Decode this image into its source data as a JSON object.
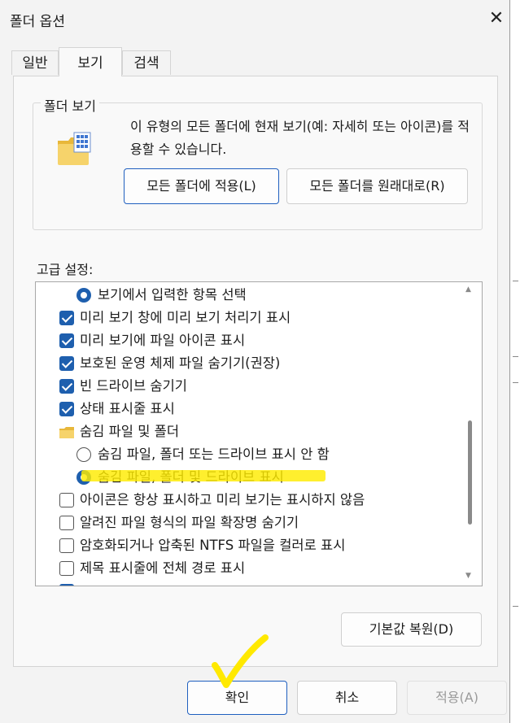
{
  "window": {
    "title": "폴더 옵션",
    "close_symbol": "✕"
  },
  "tabs": [
    {
      "label": "일반",
      "active": false
    },
    {
      "label": "보기",
      "active": true
    },
    {
      "label": "검색",
      "active": false
    }
  ],
  "folder_view": {
    "legend": "폴더 보기",
    "description": "이 유형의 모든 폴더에 현재 보기(예: 자세히 또는 아이콘)를 적용할 수 있습니다.",
    "apply_button": "모든 폴더에 적용(L)",
    "reset_button": "모든 폴더를 원래대로(R)",
    "icon": "folder-view-icon"
  },
  "advanced": {
    "label": "고급 설정:",
    "items": [
      {
        "type": "radio",
        "checked": true,
        "indent": 1,
        "label": "보기에서 입력한 항목 선택"
      },
      {
        "type": "checkbox",
        "checked": true,
        "indent": 0,
        "label": "미리 보기 창에 미리 보기 처리기 표시"
      },
      {
        "type": "checkbox",
        "checked": true,
        "indent": 0,
        "label": "미리 보기에 파일 아이콘 표시"
      },
      {
        "type": "checkbox",
        "checked": true,
        "indent": 0,
        "label": "보호된 운영 체제 파일 숨기기(권장)"
      },
      {
        "type": "checkbox",
        "checked": true,
        "indent": 0,
        "label": "빈 드라이브 숨기기"
      },
      {
        "type": "checkbox",
        "checked": true,
        "indent": 0,
        "label": "상태 표시줄 표시"
      },
      {
        "type": "folder",
        "checked": false,
        "indent": 0,
        "label": "숨김 파일 및 폴더"
      },
      {
        "type": "radio",
        "checked": false,
        "indent": 1,
        "label": "숨김 파일, 폴더 또는 드라이브 표시 안 함"
      },
      {
        "type": "radio",
        "checked": true,
        "indent": 1,
        "label": "숨김 파일, 폴더 및 드라이브 표시"
      },
      {
        "type": "checkbox",
        "checked": false,
        "indent": 0,
        "label": "아이콘은 항상 표시하고 미리 보기는 표시하지 않음"
      },
      {
        "type": "checkbox",
        "checked": false,
        "indent": 0,
        "label": "알려진 파일 형식의 파일 확장명 숨기기"
      },
      {
        "type": "checkbox",
        "checked": false,
        "indent": 0,
        "label": "암호화되거나 압축된 NTFS 파일을 컬러로 표시"
      },
      {
        "type": "checkbox",
        "checked": false,
        "indent": 0,
        "label": "제목 표시줄에 전체 경로 표시"
      },
      {
        "type": "checkbox",
        "checked": true,
        "indent": 0,
        "label": ""
      }
    ]
  },
  "restore_button": "기본값 복원(D)",
  "footer": {
    "ok": "확인",
    "cancel": "취소",
    "apply": "적용(A)"
  },
  "colors": {
    "accent": "#1e5fae",
    "highlighter": "#ffe900"
  }
}
